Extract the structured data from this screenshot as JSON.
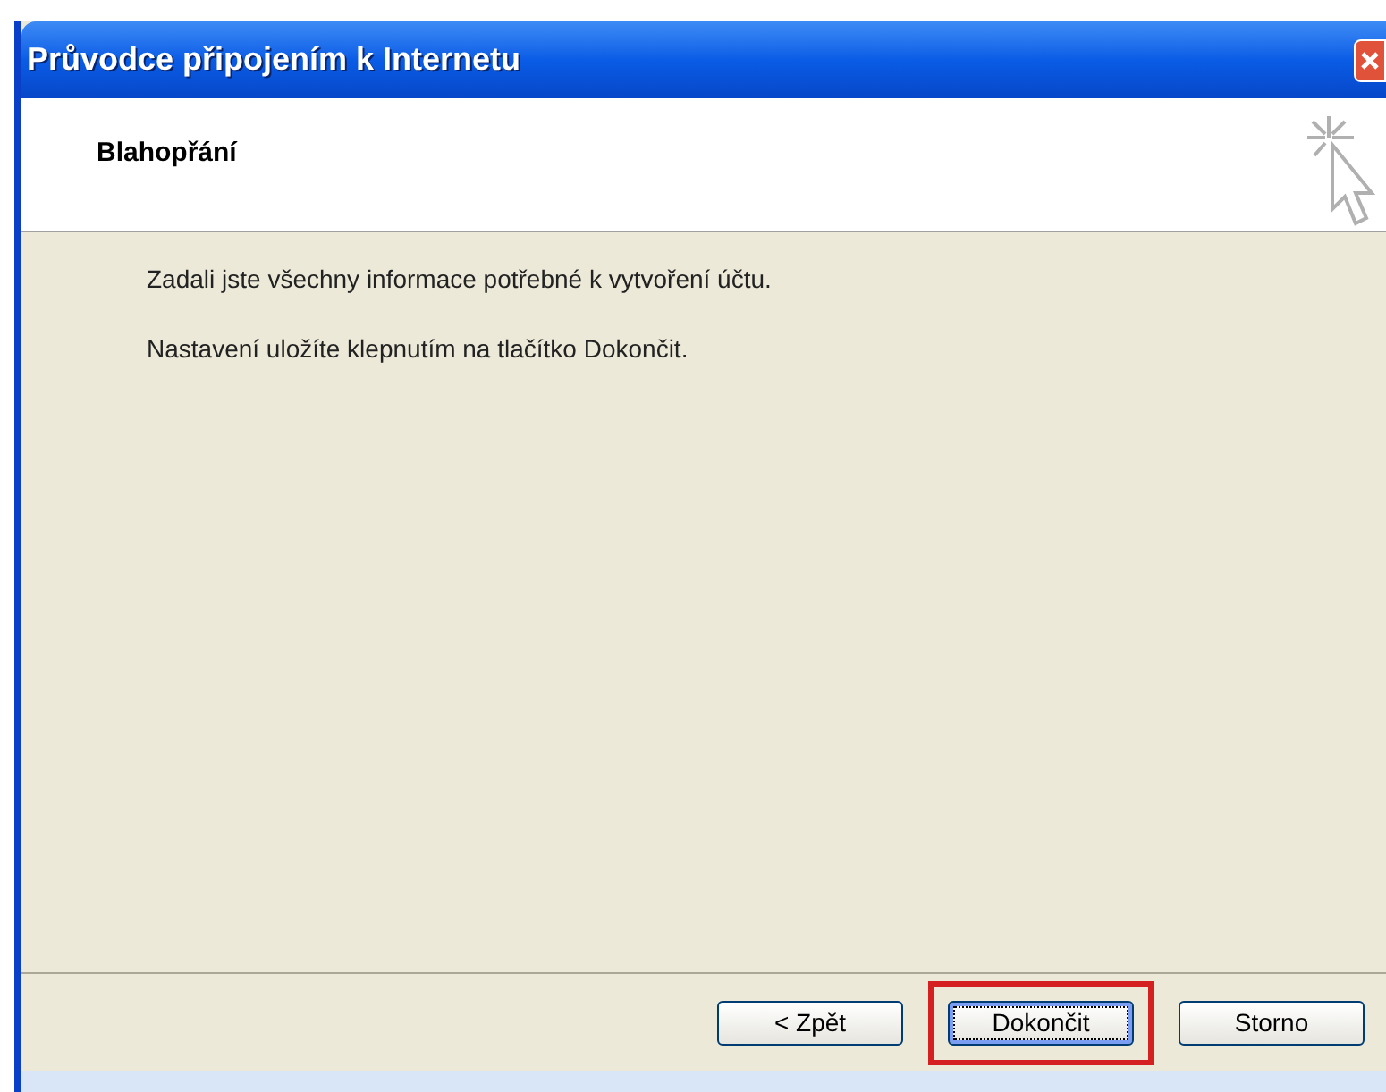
{
  "window": {
    "title": "Průvodce připojením k Internetu"
  },
  "header": {
    "title": "Blahopřání"
  },
  "body": {
    "paragraphs": [
      "Zadali jste všechny informace potřebné k vytvoření účtu.",
      "Nastavení uložíte klepnutím na tlačítko Dokončit."
    ]
  },
  "buttons": [
    {
      "label": "< Zpět",
      "focused": false,
      "highlighted": false
    },
    {
      "label": "Dokončit",
      "focused": true,
      "highlighted": true
    },
    {
      "label": "Storno",
      "focused": false,
      "highlighted": false
    }
  ]
}
